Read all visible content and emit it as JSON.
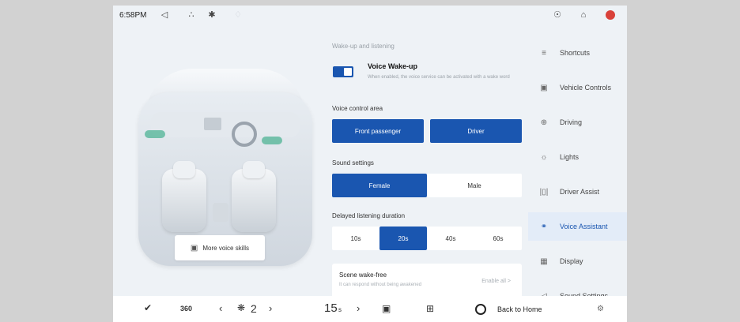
{
  "status": {
    "time": "6:58PM"
  },
  "car": {
    "voice_skills_label": "More voice skills"
  },
  "wakeup": {
    "section_label": "Wake-up and listening",
    "title": "Voice Wake-up",
    "description": "When enabled, the voice service can be activated with a wake word",
    "toggle_on": true
  },
  "control_area": {
    "label": "Voice control area",
    "options": [
      {
        "label": "Front passenger",
        "selected": true
      },
      {
        "label": "Driver",
        "selected": true
      }
    ]
  },
  "sound": {
    "label": "Sound settings",
    "options": [
      {
        "label": "Female",
        "selected": true
      },
      {
        "label": "Male",
        "selected": false
      }
    ]
  },
  "delay": {
    "label": "Delayed listening duration",
    "options": [
      {
        "label": "10s",
        "selected": false
      },
      {
        "label": "20s",
        "selected": true
      },
      {
        "label": "40s",
        "selected": false
      },
      {
        "label": "60s",
        "selected": false
      }
    ]
  },
  "scene": {
    "title": "Scene wake-free",
    "description": "It can respond without being awakened",
    "link": "Enable all >"
  },
  "sidebar": {
    "items": [
      {
        "label": "Shortcuts",
        "icon": "sliders-icon",
        "active": false
      },
      {
        "label": "Vehicle Controls",
        "icon": "car-icon",
        "active": false
      },
      {
        "label": "Driving",
        "icon": "steering-icon",
        "active": false
      },
      {
        "label": "Lights",
        "icon": "light-icon",
        "active": false
      },
      {
        "label": "Driver Assist",
        "icon": "assist-icon",
        "active": false
      },
      {
        "label": "Voice Assistant",
        "icon": "voice-icon",
        "active": true
      },
      {
        "label": "Display",
        "icon": "display-icon",
        "active": false
      },
      {
        "label": "Sound Settings",
        "icon": "speaker-icon",
        "active": false
      }
    ]
  },
  "dock": {
    "degrees_label": "360",
    "fan_value": "2",
    "temp_value": "15",
    "temp_unit": "s",
    "home_label": "Back to Home"
  },
  "colors": {
    "accent": "#1a56b0",
    "active_bg": "#e3ecf8"
  }
}
